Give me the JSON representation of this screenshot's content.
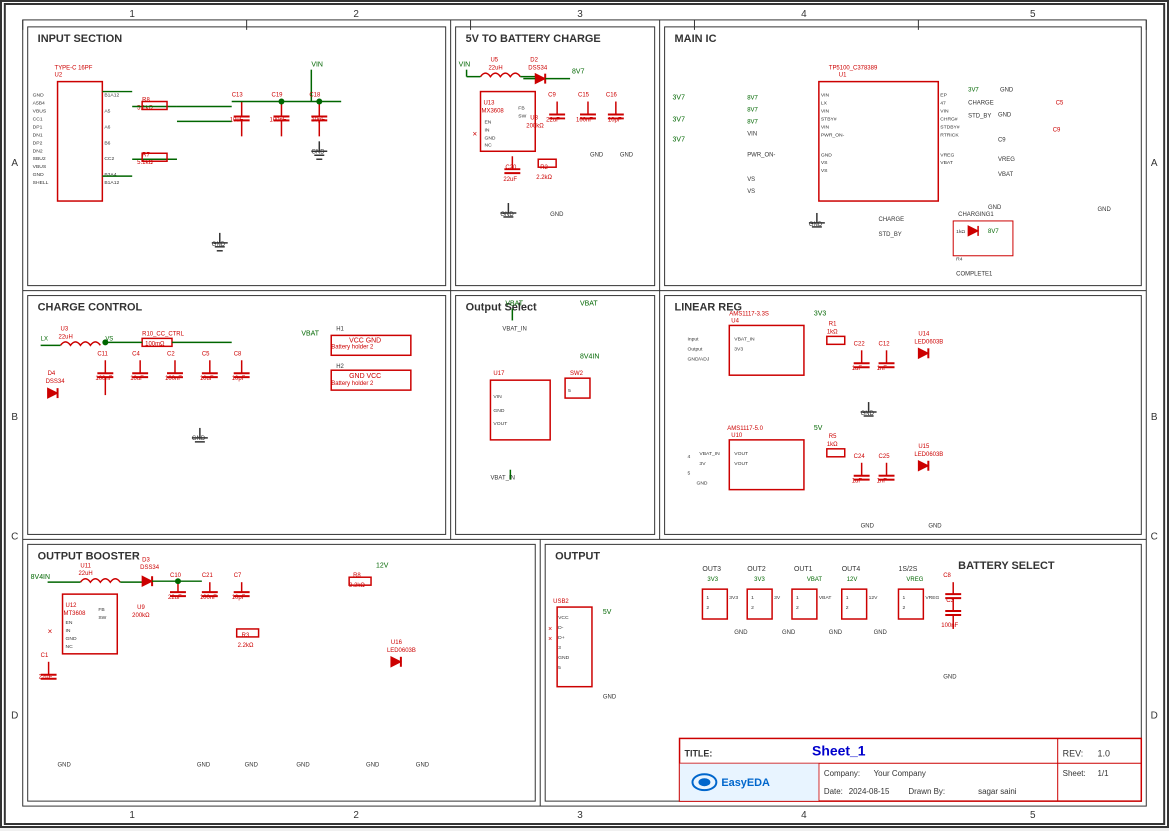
{
  "title": "Sheet_1",
  "rev": "1.0",
  "company": "Your Company",
  "date": "2024-08-15",
  "drawn_by": "sagar saini",
  "sheet": "1/1",
  "easyeda_label": "EasyEDA",
  "sections": {
    "input": "INPUT SECTION",
    "charge5v": "5V TO BATTERY CHARGE",
    "main_ic": "MAIN IC",
    "charge_control": "CHARGE CONTROL",
    "output_select": "Output Select",
    "linear_reg": "LINEAR REG",
    "output_booster": "OUTPUT BOOSTER",
    "output": "OUTPUT",
    "battery_select": "BATTERY SELECT"
  },
  "title_block": {
    "title_label": "TITLE:",
    "sheet_name": "Sheet_1",
    "rev_label": "REV:",
    "rev_value": "1.0",
    "company_label": "Company:",
    "date_label": "Date:",
    "drawn_by_label": "Drawn By:",
    "sheet_label": "Sheet:"
  }
}
